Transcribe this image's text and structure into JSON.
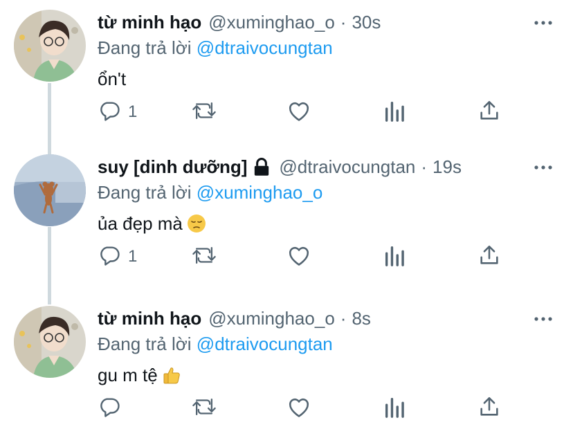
{
  "tweets": [
    {
      "name": "từ minh hạo",
      "handle": "@xuminghao_o",
      "separator": "·",
      "time": "30s",
      "reply_prefix": "Đang trả lời",
      "reply_to": "@dtraivocungtan",
      "text": "ổn't",
      "emoji": "",
      "reply_count": "1",
      "locked": false,
      "avatar": "person-avatar"
    },
    {
      "name": "suy [dinh dưỡng]",
      "handle": "@dtraivocungtan",
      "separator": "·",
      "time": "19s",
      "reply_prefix": "Đang trả lời",
      "reply_to": "@xuminghao_o",
      "text": "ủa đẹp mà",
      "emoji": "pensive-face",
      "reply_count": "1",
      "locked": true,
      "avatar": "cartoon-mouse-avatar"
    },
    {
      "name": "từ minh hạo",
      "handle": "@xuminghao_o",
      "separator": "·",
      "time": "8s",
      "reply_prefix": "Đang trả lời",
      "reply_to": "@dtraivocungtan",
      "text": "gu m tệ",
      "emoji": "thumbs-up",
      "reply_count": "",
      "locked": false,
      "avatar": "person-avatar"
    }
  ],
  "colors": {
    "text": "#0f1419",
    "secondary": "#536471",
    "link": "#1d9bf0",
    "thread_line": "#cfd9de"
  },
  "icons": [
    "reply-icon",
    "retweet-icon",
    "like-icon",
    "analytics-icon",
    "share-icon",
    "more-icon",
    "lock-icon"
  ]
}
